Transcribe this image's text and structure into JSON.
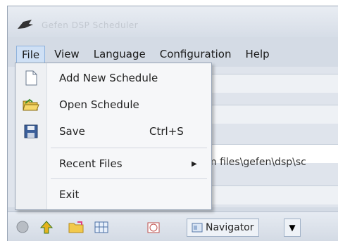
{
  "window": {
    "title": "Gefen DSP Scheduler"
  },
  "menubar": {
    "items": [
      {
        "label": "File"
      },
      {
        "label": "View"
      },
      {
        "label": "Language"
      },
      {
        "label": "Configuration"
      },
      {
        "label": "Help"
      }
    ]
  },
  "file_menu": {
    "items": [
      {
        "label": "Add New Schedule",
        "icon": "new-document-icon"
      },
      {
        "label": "Open Schedule",
        "icon": "open-folder-icon"
      },
      {
        "label": "Save",
        "shortcut": "Ctrl+S",
        "icon": "save-disk-icon"
      },
      {
        "label": "Recent Files",
        "submenu_arrow": "▶"
      },
      {
        "label": "Exit"
      }
    ]
  },
  "background": {
    "path_text": "m files\\gefen\\dsp\\sc"
  },
  "toolbar": {
    "navigator_label": "Navigator",
    "dropdown_glyph": "▼"
  }
}
